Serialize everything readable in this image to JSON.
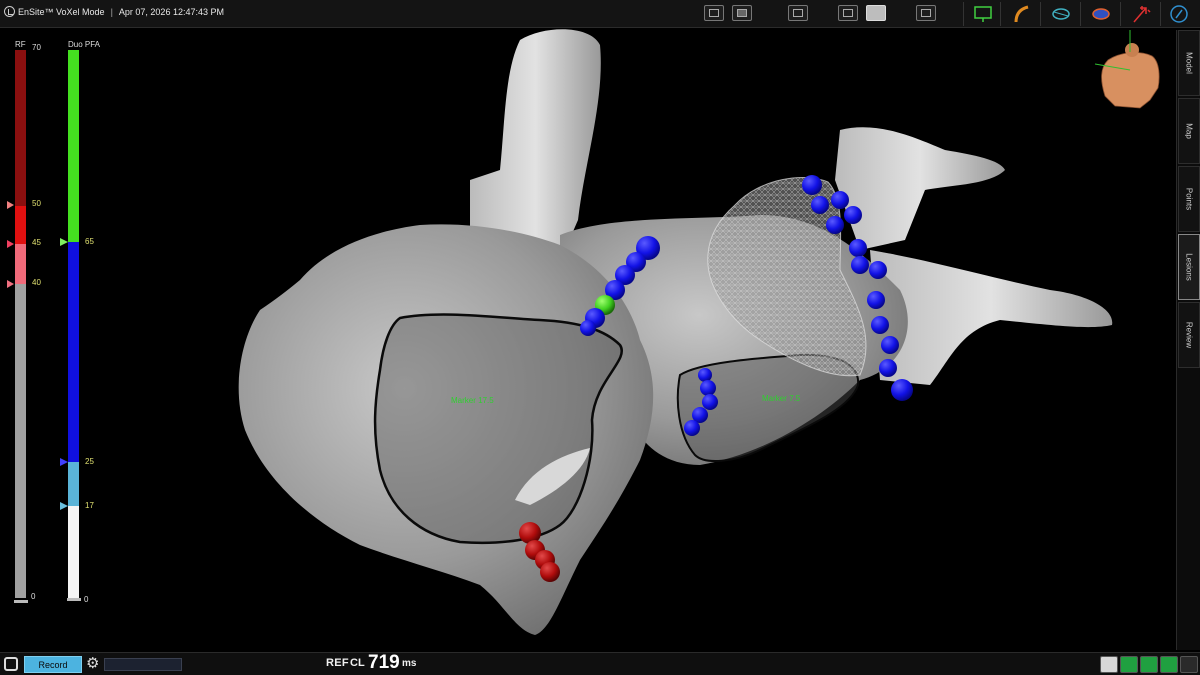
{
  "header": {
    "app_title": "EnSite™ VoXel Mode",
    "separator": "|",
    "datetime": "Apr 07, 2026 12:47:43 PM"
  },
  "scales": {
    "rf": {
      "label": "RF",
      "max_label": "70",
      "ticks": [
        "50",
        "45",
        "40"
      ],
      "min_label": "0"
    },
    "pfa": {
      "label": "Duo PFA",
      "ticks": [
        "65",
        "25",
        "17"
      ],
      "min_label": "0"
    }
  },
  "view": {
    "labels": [
      "Marker 17.5",
      "Marker 7.5"
    ]
  },
  "sidebar": {
    "tabs": [
      {
        "label": "Model"
      },
      {
        "label": "Map"
      },
      {
        "label": "Points"
      },
      {
        "label": "Lesions",
        "active": true
      },
      {
        "label": "Review"
      }
    ]
  },
  "footer": {
    "record_label": "Record",
    "ref_label": "REF",
    "cl_label": "CL",
    "cl_value": "719",
    "cl_unit": "ms"
  },
  "colors": {
    "rf_dark_red": "#8a0f0f",
    "rf_red": "#e01010",
    "rf_pink": "#f06a7a",
    "pfa_green": "#44e020",
    "pfa_blue": "#1010e0",
    "pfa_light_blue": "#5ab4d8",
    "lesion_blue": "#1a1aee",
    "lesion_red": "#b81010",
    "marker_text": "#2fd02f"
  }
}
